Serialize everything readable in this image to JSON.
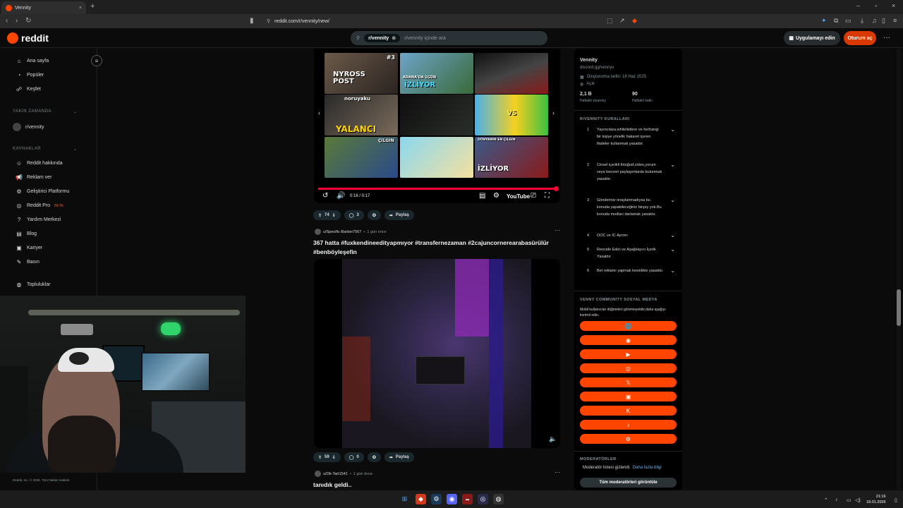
{
  "browser": {
    "tab_title": "Vennity",
    "tab_close": "×",
    "new_tab": "+",
    "url": "reddit.com/r/vennity/new/",
    "window_controls": [
      "–",
      "▫",
      "×"
    ]
  },
  "header": {
    "logo_text": "reddit",
    "search_chip": "r/vennity",
    "search_placeholder": "r/vennity içinde ara",
    "get_app_label": "Uygulamayı edin",
    "login_label": "Oturum aç",
    "more_label": "···"
  },
  "left_sidebar": {
    "nav": [
      {
        "label": "Ana sayfa",
        "icon": "home-icon"
      },
      {
        "label": "Popüler",
        "icon": "popular-icon"
      },
      {
        "label": "Keşfet",
        "icon": "explore-icon"
      }
    ],
    "recent_heading": "YAKIN ZAMANDA",
    "recent": [
      {
        "label": "r/vennity"
      }
    ],
    "resources_heading": "KAYNAKLAR",
    "resources": [
      {
        "label": "Reddit hakkında"
      },
      {
        "label": "Reklam ver"
      },
      {
        "label": "Geliştirici Platformu"
      },
      {
        "label": "Reddit Pro",
        "badge": "BETA"
      },
      {
        "label": "Yardım Merkezi"
      },
      {
        "label": "Blog"
      },
      {
        "label": "Kariyer"
      },
      {
        "label": "Basın"
      }
    ],
    "communities_label": "Topluluklar",
    "copyright": "Reddit, Inc. © 2026. Tüm hakları saklıdır."
  },
  "post1": {
    "thumb_texts": [
      "#3",
      "NYROSS POST",
      "ADANA'DA 1GÜN",
      "İZLİYOR",
      "noruyaku",
      "YALANCI",
      "VS",
      "ÇILGIN",
      "DÜNYANIN EN ÇILGIN",
      "İZLİYOR"
    ],
    "time": "0:16 / 0:17",
    "progress": 1.0,
    "votes": "74",
    "comments": "3",
    "share_label": "Paylaş",
    "youtube_label": "YouTube"
  },
  "post2": {
    "author": "u/Specific-Barber7567",
    "time": "1 gün önce",
    "title": "367 hatta #fuxkendineedityapmıyor #transfernezaman #2cajuncornerearabasürülür #benböyleşefin",
    "votes": "59",
    "comments": "0",
    "share_label": "Paylaş"
  },
  "post3": {
    "author": "u/Ok-Tart1541",
    "time": "1 gün önce",
    "title": "tanıdık geldi.."
  },
  "right_sidebar": {
    "name": "Vennity",
    "link": "discord.gg/vennyv",
    "created": "Oluşturulma tarihi: 18 Haz 2025",
    "visibility": "Açık",
    "stats": [
      {
        "value": "2,1 B",
        "label": "Haftalık ziyaretçi"
      },
      {
        "value": "90",
        "label": "Haftalık katkı"
      }
    ],
    "rules_heading": "R/VENNITY KURALLARI",
    "rules": [
      {
        "num": "1",
        "text": "Yayıncılara,whitelistlere ve herhangi bir kişiye yönelik hakaret içeren ifadeler kullanmak yasaktır."
      },
      {
        "num": "2",
        "text": "Cinsel içerikli fotoğraf,video,yorum veya benzeri paylaşımlarda bulunmak yasaktır."
      },
      {
        "num": "3",
        "text": "Gönderiniz onaylanmadıysa bu konuda yapabileceğiniz birşey yok.Bu konuda modları darlamak yasaktır."
      },
      {
        "num": "4",
        "text": "OOC ve IC Ayrımı"
      },
      {
        "num": "5",
        "text": "Rencide Edici ve Aşağılayıcı İçerik Yasaktır"
      },
      {
        "num": "6",
        "text": "Bet reklamı yapmak kesinlikle yasaktır."
      }
    ],
    "social_heading": "VENNY COMMUNITY SOSYAL MEDYA",
    "social_note": "Mobil kullanıcılar düğmeleri göremeyebilir,daha aşağıyı kontrol edin.",
    "social_buttons": [
      {
        "icon": "globe-icon",
        "glyph": "🌐"
      },
      {
        "icon": "discord-icon",
        "glyph": "◉"
      },
      {
        "icon": "youtube-icon",
        "glyph": "▶"
      },
      {
        "icon": "instagram-icon",
        "glyph": "◎"
      },
      {
        "icon": "x-icon",
        "glyph": "𝕏"
      },
      {
        "icon": "twitch-icon",
        "glyph": "▣"
      },
      {
        "icon": "kick-icon",
        "glyph": "K"
      },
      {
        "icon": "tiktok-icon",
        "glyph": "♪"
      },
      {
        "icon": "steam-icon",
        "glyph": "⚙"
      }
    ],
    "mods_heading": "MODERATÖRLER",
    "mods_hidden": "Moderatör listesi gizlendi.",
    "mods_more": "Daha fazla bilgi",
    "mods_button": "Tüm moderatörleri görüntüle"
  },
  "taskbar": {
    "time": "21:16",
    "date": "18.01.2026"
  },
  "colors": {
    "accent": "#ff4500",
    "login": "#d93900",
    "background": "#0b0b0b"
  }
}
